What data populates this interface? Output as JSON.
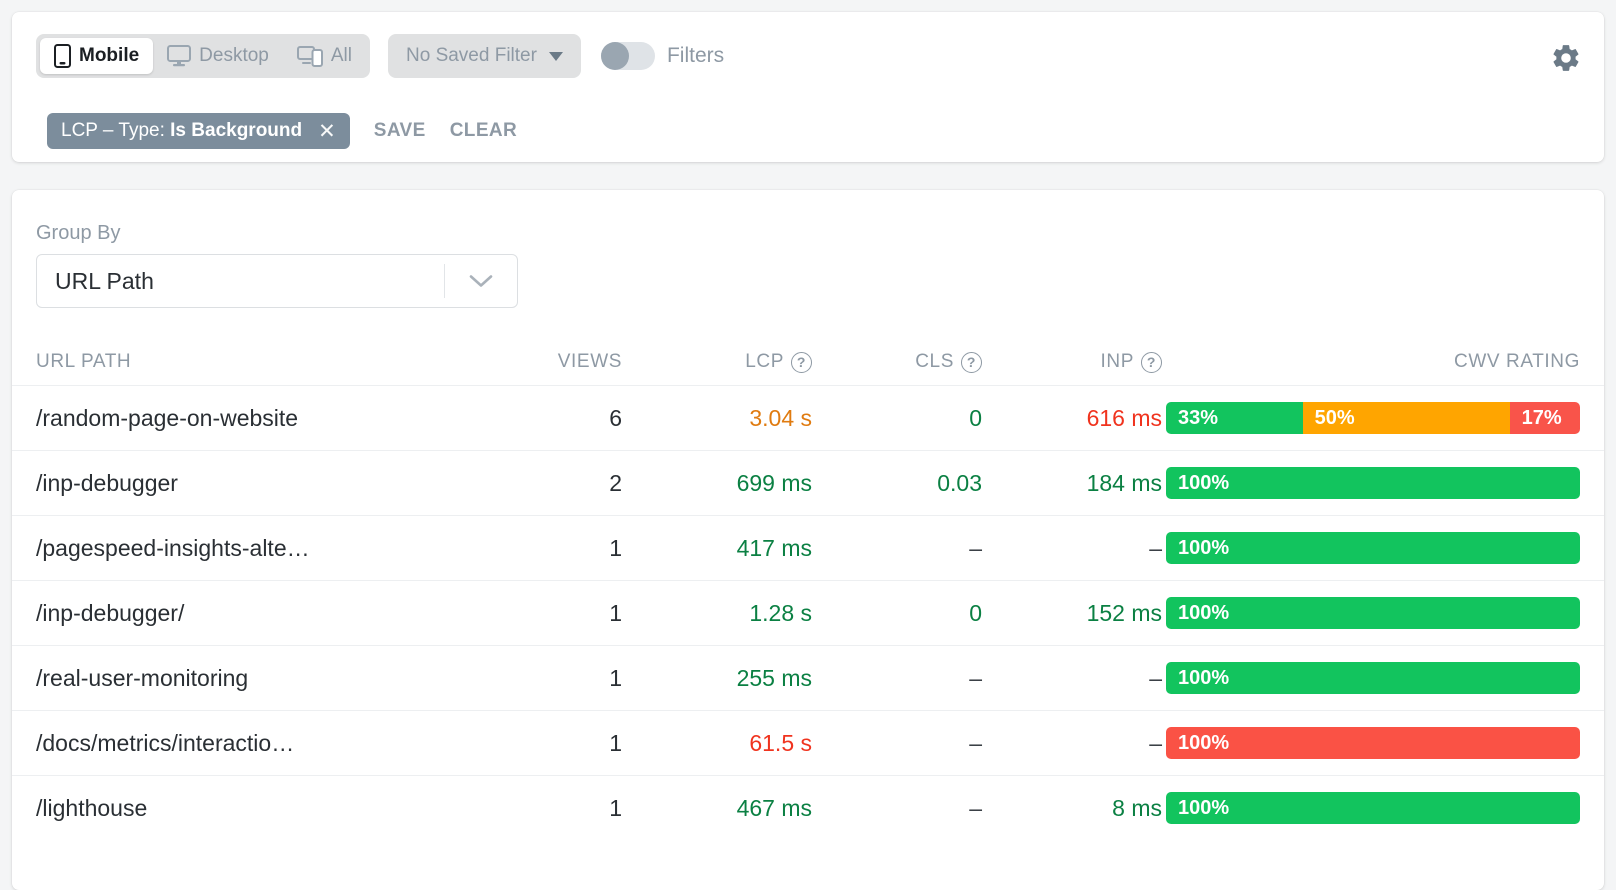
{
  "toolbar": {
    "devices": [
      {
        "id": "mobile",
        "label": "Mobile",
        "icon": "mobile-icon",
        "active": true
      },
      {
        "id": "desktop",
        "label": "Desktop",
        "icon": "desktop-icon",
        "active": false
      },
      {
        "id": "all",
        "label": "All",
        "icon": "all-devices-icon",
        "active": false
      }
    ],
    "saved_filter": "No Saved Filter",
    "filters_toggle_label": "Filters",
    "filters_toggle_on": false,
    "settings_icon": "gear-icon"
  },
  "filter_chip": {
    "prefix": "LCP – Type:",
    "value": "Is Background",
    "close_icon": "close-icon",
    "save_label": "SAVE",
    "clear_label": "CLEAR"
  },
  "group_by": {
    "label": "Group By",
    "selected": "URL Path",
    "chevron_icon": "chevron-down-icon"
  },
  "table": {
    "columns": [
      {
        "key": "path",
        "label": "URL PATH",
        "help": false
      },
      {
        "key": "views",
        "label": "VIEWS",
        "help": false
      },
      {
        "key": "lcp",
        "label": "LCP",
        "help": true
      },
      {
        "key": "cls",
        "label": "CLS",
        "help": true
      },
      {
        "key": "inp",
        "label": "INP",
        "help": true
      },
      {
        "key": "cwv",
        "label": "CWV RATING",
        "help": false
      }
    ],
    "help_glyph": "?",
    "rows": [
      {
        "path": "/random-page-on-website",
        "views": "6",
        "lcp": {
          "text": "3.04 s",
          "rating": "ni"
        },
        "cls": {
          "text": "0",
          "rating": "good"
        },
        "inp": {
          "text": "616 ms",
          "rating": "poor"
        },
        "cwv": [
          {
            "label": "33%",
            "pct": 33,
            "color": "#12c45e"
          },
          {
            "label": "50%",
            "pct": 50,
            "color": "#ffa500"
          },
          {
            "label": "17%",
            "pct": 17,
            "color": "#f9544a"
          }
        ]
      },
      {
        "path": "/inp-debugger",
        "views": "2",
        "lcp": {
          "text": "699 ms",
          "rating": "good"
        },
        "cls": {
          "text": "0.03",
          "rating": "good"
        },
        "inp": {
          "text": "184 ms",
          "rating": "good"
        },
        "cwv": [
          {
            "label": "100%",
            "pct": 100,
            "color": "#12c45e"
          }
        ]
      },
      {
        "path": "/pagespeed-insights-alte…",
        "views": "1",
        "lcp": {
          "text": "417 ms",
          "rating": "good"
        },
        "cls": {
          "text": "–",
          "rating": "none"
        },
        "inp": {
          "text": "–",
          "rating": "none"
        },
        "cwv": [
          {
            "label": "100%",
            "pct": 100,
            "color": "#12c45e"
          }
        ]
      },
      {
        "path": "/inp-debugger/",
        "views": "1",
        "lcp": {
          "text": "1.28 s",
          "rating": "good"
        },
        "cls": {
          "text": "0",
          "rating": "good"
        },
        "inp": {
          "text": "152 ms",
          "rating": "good"
        },
        "cwv": [
          {
            "label": "100%",
            "pct": 100,
            "color": "#12c45e"
          }
        ]
      },
      {
        "path": "/real-user-monitoring",
        "views": "1",
        "lcp": {
          "text": "255 ms",
          "rating": "good"
        },
        "cls": {
          "text": "–",
          "rating": "none"
        },
        "inp": {
          "text": "–",
          "rating": "none"
        },
        "cwv": [
          {
            "label": "100%",
            "pct": 100,
            "color": "#12c45e"
          }
        ]
      },
      {
        "path": "/docs/metrics/interactio…",
        "views": "1",
        "lcp": {
          "text": "61.5 s",
          "rating": "poor"
        },
        "cls": {
          "text": "–",
          "rating": "none"
        },
        "inp": {
          "text": "–",
          "rating": "none"
        },
        "cwv": [
          {
            "label": "100%",
            "pct": 100,
            "color": "#fa5245"
          }
        ]
      },
      {
        "path": "/lighthouse",
        "views": "1",
        "lcp": {
          "text": "467 ms",
          "rating": "good"
        },
        "cls": {
          "text": "–",
          "rating": "none"
        },
        "inp": {
          "text": "8 ms",
          "rating": "good"
        },
        "cwv": [
          {
            "label": "100%",
            "pct": 100,
            "color": "#12c45e"
          }
        ]
      }
    ]
  },
  "colors": {
    "good": "#0b8043",
    "needs_improvement": "#e07b10",
    "poor": "#f0331e",
    "bar_green": "#12c45e",
    "bar_orange": "#ffa500",
    "bar_red": "#f9544a",
    "chip_bg": "#7c8d9c"
  }
}
